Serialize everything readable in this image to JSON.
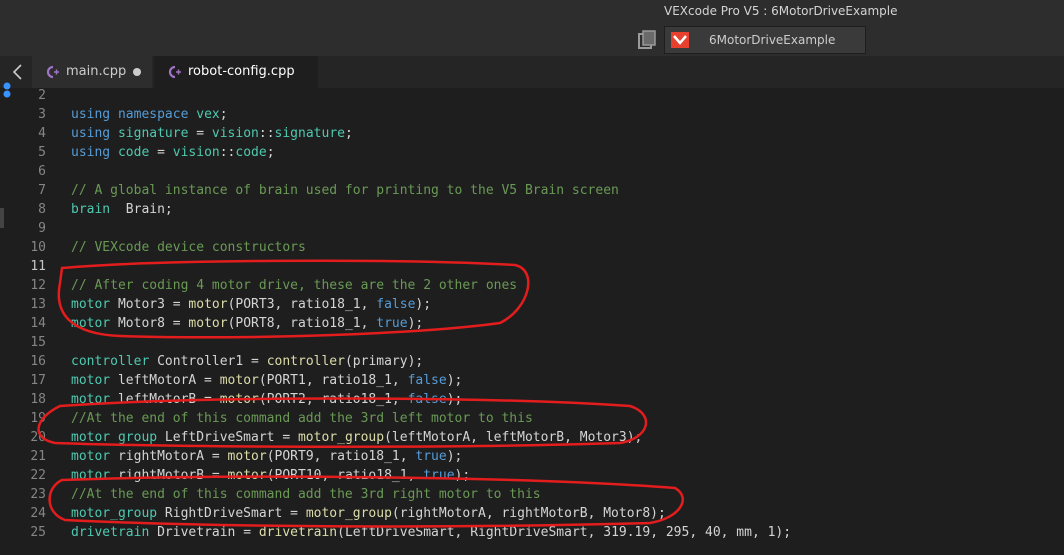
{
  "window": {
    "title": "VEXcode Pro V5 : 6MotorDriveExample",
    "project_tab": "6MotorDriveExample"
  },
  "tabs": [
    {
      "label": "main.cpp",
      "modified": true,
      "active": false
    },
    {
      "label": "robot-config.cpp",
      "modified": false,
      "active": true
    }
  ],
  "editor": {
    "current_line": "11",
    "lines": [
      {
        "n": "2",
        "tokens": []
      },
      {
        "n": "3",
        "tokens": [
          [
            "kw",
            "using"
          ],
          [
            "tx",
            " "
          ],
          [
            "kw",
            "namespace"
          ],
          [
            "tx",
            " "
          ],
          [
            "ty",
            "vex"
          ],
          [
            "tx",
            ";"
          ]
        ]
      },
      {
        "n": "4",
        "tokens": [
          [
            "kw",
            "using"
          ],
          [
            "tx",
            " "
          ],
          [
            "ty",
            "signature"
          ],
          [
            "tx",
            " = "
          ],
          [
            "ty",
            "vision"
          ],
          [
            "tx",
            "::"
          ],
          [
            "ty",
            "signature"
          ],
          [
            "tx",
            ";"
          ]
        ]
      },
      {
        "n": "5",
        "tokens": [
          [
            "kw",
            "using"
          ],
          [
            "tx",
            " "
          ],
          [
            "ty",
            "code"
          ],
          [
            "tx",
            " = "
          ],
          [
            "ty",
            "vision"
          ],
          [
            "tx",
            "::"
          ],
          [
            "ty",
            "code"
          ],
          [
            "tx",
            ";"
          ]
        ]
      },
      {
        "n": "6",
        "tokens": []
      },
      {
        "n": "7",
        "tokens": [
          [
            "cm",
            "// A global instance of brain used for printing to the V5 Brain screen"
          ]
        ]
      },
      {
        "n": "8",
        "tokens": [
          [
            "ty",
            "brain"
          ],
          [
            "tx",
            "  Brain;"
          ]
        ]
      },
      {
        "n": "9",
        "tokens": []
      },
      {
        "n": "10",
        "tokens": [
          [
            "cm",
            "// VEXcode device constructors"
          ]
        ]
      },
      {
        "n": "11",
        "tokens": []
      },
      {
        "n": "12",
        "tokens": [
          [
            "cm",
            "// After coding 4 motor drive, these are the 2 other ones"
          ]
        ]
      },
      {
        "n": "13",
        "tokens": [
          [
            "ty",
            "motor"
          ],
          [
            "tx",
            " Motor3 = "
          ],
          [
            "fn",
            "motor"
          ],
          [
            "tx",
            "(PORT3, ratio18_1, "
          ],
          [
            "kw",
            "false"
          ],
          [
            "tx",
            ");"
          ]
        ]
      },
      {
        "n": "14",
        "tokens": [
          [
            "ty",
            "motor"
          ],
          [
            "tx",
            " Motor8 = "
          ],
          [
            "fn",
            "motor"
          ],
          [
            "tx",
            "(PORT8, ratio18_1, "
          ],
          [
            "kw",
            "true"
          ],
          [
            "tx",
            ");"
          ]
        ]
      },
      {
        "n": "15",
        "tokens": []
      },
      {
        "n": "16",
        "tokens": [
          [
            "ty",
            "controller"
          ],
          [
            "tx",
            " Controller1 = "
          ],
          [
            "fn",
            "controller"
          ],
          [
            "tx",
            "(primary);"
          ]
        ]
      },
      {
        "n": "17",
        "tokens": [
          [
            "ty",
            "motor"
          ],
          [
            "tx",
            " leftMotorA = "
          ],
          [
            "fn",
            "motor"
          ],
          [
            "tx",
            "(PORT1, ratio18_1, "
          ],
          [
            "kw",
            "false"
          ],
          [
            "tx",
            ");"
          ]
        ]
      },
      {
        "n": "18",
        "tokens": [
          [
            "ty",
            "motor"
          ],
          [
            "tx",
            " leftMotorB = "
          ],
          [
            "fn",
            "motor"
          ],
          [
            "tx",
            "(PORT2, ratio18_1, "
          ],
          [
            "kw",
            "false"
          ],
          [
            "tx",
            ");"
          ]
        ]
      },
      {
        "n": "19",
        "tokens": [
          [
            "cm",
            "//At the end of this command add the 3rd left motor to this"
          ]
        ]
      },
      {
        "n": "20",
        "tokens": [
          [
            "ty",
            "motor_group"
          ],
          [
            "tx",
            " LeftDriveSmart = "
          ],
          [
            "fn",
            "motor_group"
          ],
          [
            "tx",
            "(leftMotorA, leftMotorB, Motor3);"
          ]
        ]
      },
      {
        "n": "21",
        "tokens": [
          [
            "ty",
            "motor"
          ],
          [
            "tx",
            " rightMotorA = "
          ],
          [
            "fn",
            "motor"
          ],
          [
            "tx",
            "(PORT9, ratio18_1, "
          ],
          [
            "kw",
            "true"
          ],
          [
            "tx",
            ");"
          ]
        ]
      },
      {
        "n": "22",
        "tokens": [
          [
            "ty",
            "motor"
          ],
          [
            "tx",
            " rightMotorB = "
          ],
          [
            "fn",
            "motor"
          ],
          [
            "tx",
            "(PORT10, ratio18_1, "
          ],
          [
            "kw",
            "true"
          ],
          [
            "tx",
            ");"
          ]
        ]
      },
      {
        "n": "23",
        "tokens": [
          [
            "cm",
            "//At the end of this command add the 3rd right motor to this"
          ]
        ]
      },
      {
        "n": "24",
        "tokens": [
          [
            "ty",
            "motor_group"
          ],
          [
            "tx",
            " RightDriveSmart = "
          ],
          [
            "fn",
            "motor_group"
          ],
          [
            "tx",
            "(rightMotorA, rightMotorB, Motor8);"
          ]
        ]
      },
      {
        "n": "25",
        "tokens": [
          [
            "ty",
            "drivetrain"
          ],
          [
            "tx",
            " Drivetrain = "
          ],
          [
            "fn",
            "drivetrain"
          ],
          [
            "tx",
            "(LeftDriveSmart, RightDriveSmart, 319.19, 295, 40, mm, 1);"
          ]
        ]
      }
    ]
  },
  "colors": {
    "keyword": "#569cd6",
    "type": "#4ec9b0",
    "function": "#dcdcaa",
    "comment": "#6a9955",
    "annotation": "#e31d1d",
    "vex_red": "#e8402f"
  },
  "icons": [
    "back-arrow-icon",
    "copy-window-icon",
    "vex-logo-icon",
    "cpp-file-icon",
    "unsaved-dot-icon"
  ]
}
